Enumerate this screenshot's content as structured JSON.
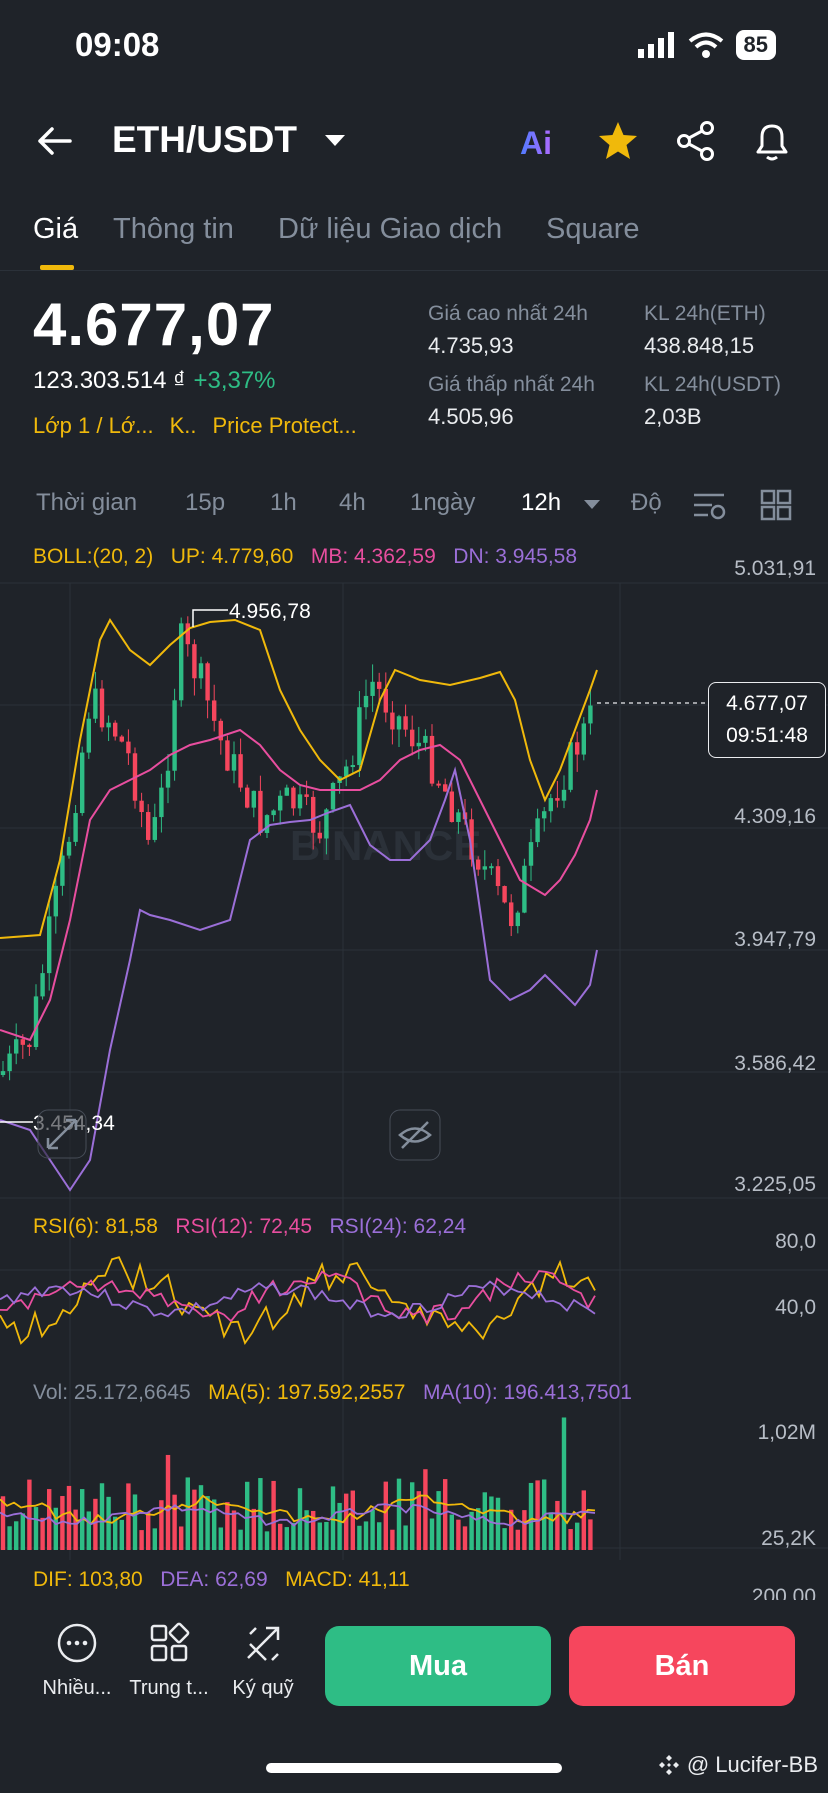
{
  "status_bar": {
    "time": "09:08",
    "battery": "85"
  },
  "header": {
    "pair": "ETH/USDT",
    "ai_label": "Ai"
  },
  "tabs": [
    "Giá",
    "Thông tin",
    "Dữ liệu Giao dịch",
    "Square"
  ],
  "ticker": {
    "last_price": "4.677,07",
    "fiat_price": "123.303.514 ₫",
    "change": "+3,37%",
    "tags": [
      "Lớp 1 / Lớ...",
      "K..",
      "Price Protect..."
    ],
    "high_label": "Giá cao nhất 24h",
    "high_value": "4.735,93",
    "low_label": "Giá thấp nhất 24h",
    "low_value": "4.505,96",
    "vol_eth_label": "KL 24h(ETH)",
    "vol_eth_value": "438.848,15",
    "vol_usdt_label": "KL 24h(USDT)",
    "vol_usdt_value": "2,03B"
  },
  "intervals": {
    "time": "Thời gian",
    "m15": "15p",
    "h1": "1h",
    "h4": "4h",
    "d1": "1ngày",
    "h12": "12h",
    "depth": "Độ"
  },
  "indicators": {
    "boll": "BOLL:(20, 2)",
    "up": "UP: 4.779,60",
    "mb": "MB: 4.362,59",
    "dn": "DN: 3.945,58",
    "rsi6": "RSI(6): 81,58",
    "rsi12": "RSI(12): 72,45",
    "rsi24": "RSI(24): 62,24",
    "vol": "Vol: 25.172,6645",
    "ma5": "MA(5): 197.592,2557",
    "ma10": "MA(10): 196.413,7501",
    "dif": "DIF: 103,80",
    "dea": "DEA: 62,69",
    "macd": "MACD: 41,11"
  },
  "axis": {
    "price": [
      "5.031,91",
      "4.309,16",
      "3.947,79",
      "3.586,42",
      "3.225,05"
    ],
    "rsi": [
      "80,0",
      "40,0"
    ],
    "vol": [
      "1,02M",
      "25,2K"
    ],
    "macd": "200,00"
  },
  "chart_labels": {
    "high_marker": "4.956,78",
    "low_marker": "3.454,34",
    "current_price": "4.677,07",
    "countdown": "09:51:48",
    "watermark": "BINANCE"
  },
  "bottom": {
    "more": "Nhiều...",
    "hub": "Trung t...",
    "margin": "Ký quỹ",
    "buy": "Mua",
    "sell": "Bán"
  },
  "credit": "@ Lucifer-BB",
  "colors": {
    "bg": "#1f2329",
    "up": "#2ebd85",
    "down": "#f6465d",
    "accent": "#f0b90b",
    "pink": "#e84e9f",
    "purple": "#9b6fd8"
  }
}
